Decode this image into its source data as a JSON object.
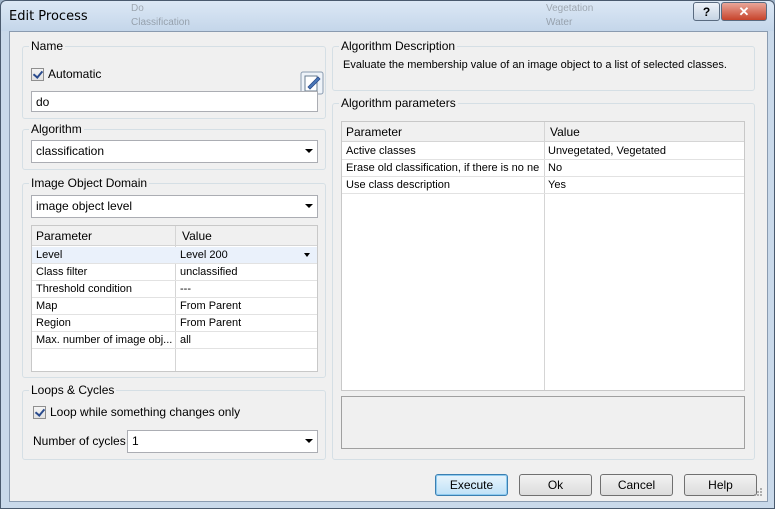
{
  "window": {
    "title": "Edit Process",
    "help_label": "?",
    "close_label": "✕",
    "background_tree": [
      "Do",
      "Classification",
      "Vegetation",
      "Water"
    ]
  },
  "name_group": {
    "label": "Name",
    "automatic_label": "Automatic",
    "automatic_checked": true,
    "name_value": "do"
  },
  "algorithm_group": {
    "label": "Algorithm",
    "selected": "classification"
  },
  "domain_group": {
    "label": "Image Object Domain",
    "selected": "image object level",
    "columns": [
      "Parameter",
      "Value"
    ],
    "rows": [
      {
        "param": "Level",
        "value": "Level 200"
      },
      {
        "param": "Class filter",
        "value": "unclassified"
      },
      {
        "param": "Threshold condition",
        "value": "---"
      },
      {
        "param": "Map",
        "value": "From Parent"
      },
      {
        "param": "Region",
        "value": "From Parent"
      },
      {
        "param": "Max. number of image obj...",
        "value": "all"
      }
    ]
  },
  "loops_group": {
    "label": "Loops & Cycles",
    "loop_label": "Loop while something changes only",
    "loop_checked": true,
    "cycles_label": "Number of cycles",
    "cycles_value": "1"
  },
  "description_group": {
    "label": "Algorithm Description",
    "text": "Evaluate the membership value of an image object to a list of selected classes."
  },
  "params_group": {
    "label": "Algorithm parameters",
    "columns": [
      "Parameter",
      "Value"
    ],
    "rows": [
      {
        "param": "Active classes",
        "value": "Unvegetated, Vegetated"
      },
      {
        "param": "Erase old classification, if there is no ne...",
        "value": "No"
      },
      {
        "param": "Use class description",
        "value": "Yes"
      }
    ]
  },
  "buttons": {
    "execute": "Execute",
    "ok": "Ok",
    "cancel": "Cancel",
    "help": "Help"
  },
  "colors": {
    "accent": "#3c7fb1",
    "close": "#c7432b"
  }
}
